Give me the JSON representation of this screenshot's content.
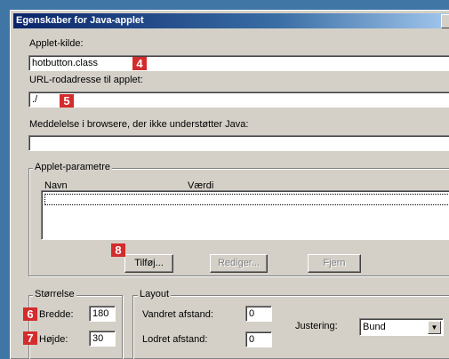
{
  "window": {
    "title": "Egenskaber for Java-applet"
  },
  "source": {
    "label": "Applet-kilde:",
    "value": "hotbutton.class",
    "badge": "4"
  },
  "base_url": {
    "label": "URL-rodadresse til applet:",
    "value": "./",
    "badge": "5"
  },
  "message": {
    "label": "Meddelelse i browsere, der ikke understøtter Java:",
    "value": ""
  },
  "params": {
    "group_title": "Applet-parametre",
    "col_name": "Navn",
    "col_value": "Værdi",
    "add_label": "Tilføj...",
    "add_badge": "8",
    "edit_label": "Rediger...",
    "remove_label": "Fjern"
  },
  "size": {
    "group_title": "Størrelse",
    "width_label": "Bredde:",
    "width_value": "180",
    "width_badge": "6",
    "height_label": "Højde:",
    "height_value": "30",
    "height_badge": "7"
  },
  "layout": {
    "group_title": "Layout",
    "hspace_label": "Vandret afstand:",
    "hspace_value": "0",
    "vspace_label": "Lodret afstand:",
    "vspace_value": "0",
    "align_label": "Justering:",
    "align_value": "Bund"
  },
  "colors": {
    "badge": "#d42c2c",
    "desktop": "#3f76a6",
    "titlebar": "#0a246a"
  }
}
